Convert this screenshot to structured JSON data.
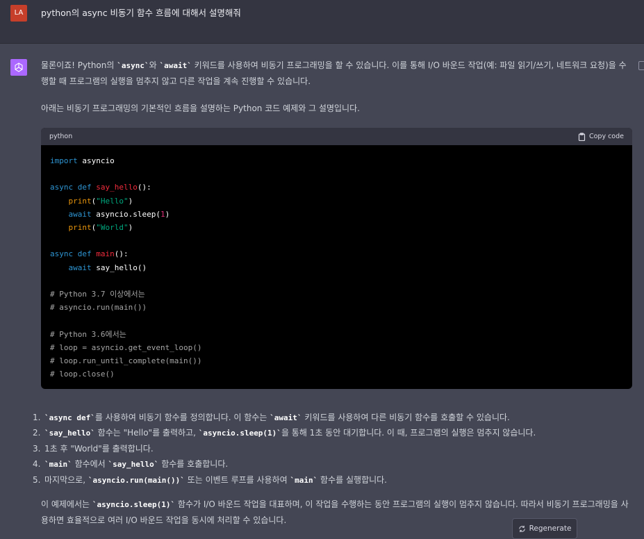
{
  "user": {
    "avatar_initials": "LA",
    "message": "python의 async 비동기 함수 흐름에 대해서 설명해줘"
  },
  "assistant": {
    "intro_a": "물론이죠! Python의 ",
    "intro_code1": "`async`",
    "intro_b": "와 ",
    "intro_code2": "`await`",
    "intro_c": " 키워드를 사용하여 비동기 프로그래밍을 할 수 있습니다. 이를 통해 I/O 바운드 작업(예: 파일 읽기/쓰기, 네트워크 요청)을 수행할 때 프로그램의 실행을 멈추지 않고 다른 작업을 계속 진행할 수 있습니다.",
    "intro2": "아래는 비동기 프로그래밍의 기본적인 흐름을 설명하는 Python 코드 예제와 그 설명입니다.",
    "code_block": {
      "language": "python",
      "copy_label": "Copy code",
      "lines": {
        "l1_kw": "import",
        "l1_rest": " asyncio",
        "l3_kw": "async def",
        "l3_fn": "say_hello",
        "l3_rest": "():",
        "l4_bi": "print",
        "l4_str": "\"Hello\"",
        "l5_kw": "await",
        "l5_rest": " asyncio.sleep(",
        "l5_num": "1",
        "l5_end": ")",
        "l6_bi": "print",
        "l6_str": "\"World\"",
        "l8_kw": "async def",
        "l8_fn": "main",
        "l8_rest": "():",
        "l9_kw": "await",
        "l9_rest": " say_hello()",
        "c1": "# Python 3.7 이상에서는",
        "c2": "# asyncio.run(main())",
        "c3": "# Python 3.6에서는",
        "c4": "# loop = asyncio.get_event_loop()",
        "c5": "# loop.run_until_complete(main())",
        "c6": "# loop.close()"
      }
    },
    "list": [
      {
        "num": "1.",
        "a": "",
        "code1": "`async def`",
        "b": "를 사용하여 비동기 함수를 정의합니다. 이 함수는 ",
        "code2": "`await`",
        "c": " 키워드를 사용하여 다른 비동기 함수를 호출할 수 있습니다."
      },
      {
        "num": "2.",
        "a": "",
        "code1": "`say_hello`",
        "b": " 함수는 \"Hello\"를 출력하고, ",
        "code2": "`asyncio.sleep(1)`",
        "c": "을 통해 1초 동안 대기합니다. 이 때, 프로그램의 실행은 멈추지 않습니다."
      },
      {
        "num": "3.",
        "a": "1초 후 \"World\"를 출력합니다.",
        "code1": "",
        "b": "",
        "code2": "",
        "c": ""
      },
      {
        "num": "4.",
        "a": "",
        "code1": "`main`",
        "b": " 함수에서 ",
        "code2": "`say_hello`",
        "c": " 함수를 호출합니다."
      },
      {
        "num": "5.",
        "a": "마지막으로, ",
        "code1": "`asyncio.run(main())`",
        "b": " 또는 이벤트 루프를 사용하여 ",
        "code2": "`main`",
        "c": " 함수를 실행합니다."
      }
    ],
    "outro_a": "이 예제에서는 ",
    "outro_code": "`asyncio.sleep(1)`",
    "outro_b": " 함수가 I/O 바운드 작업을 대표하며, 이 작업을 수행하는 동안 프로그램의 실행이 멈추지 않습니다. 따라서 비동기 프로그래밍을 사용하면 효율적으로 여러 I/O 바운드 작업을 동시에 처리할 수 있습니다."
  },
  "regenerate_label": "Regenerate",
  "icons": {
    "assistant_avatar": "openai-logo-icon",
    "copy": "clipboard-icon",
    "regenerate": "refresh-icon"
  },
  "colors": {
    "background": "#444654",
    "user_row": "#343541",
    "user_avatar": "#c63f2a",
    "assistant_avatar": "#ab68ff",
    "code_bg": "#000000"
  }
}
